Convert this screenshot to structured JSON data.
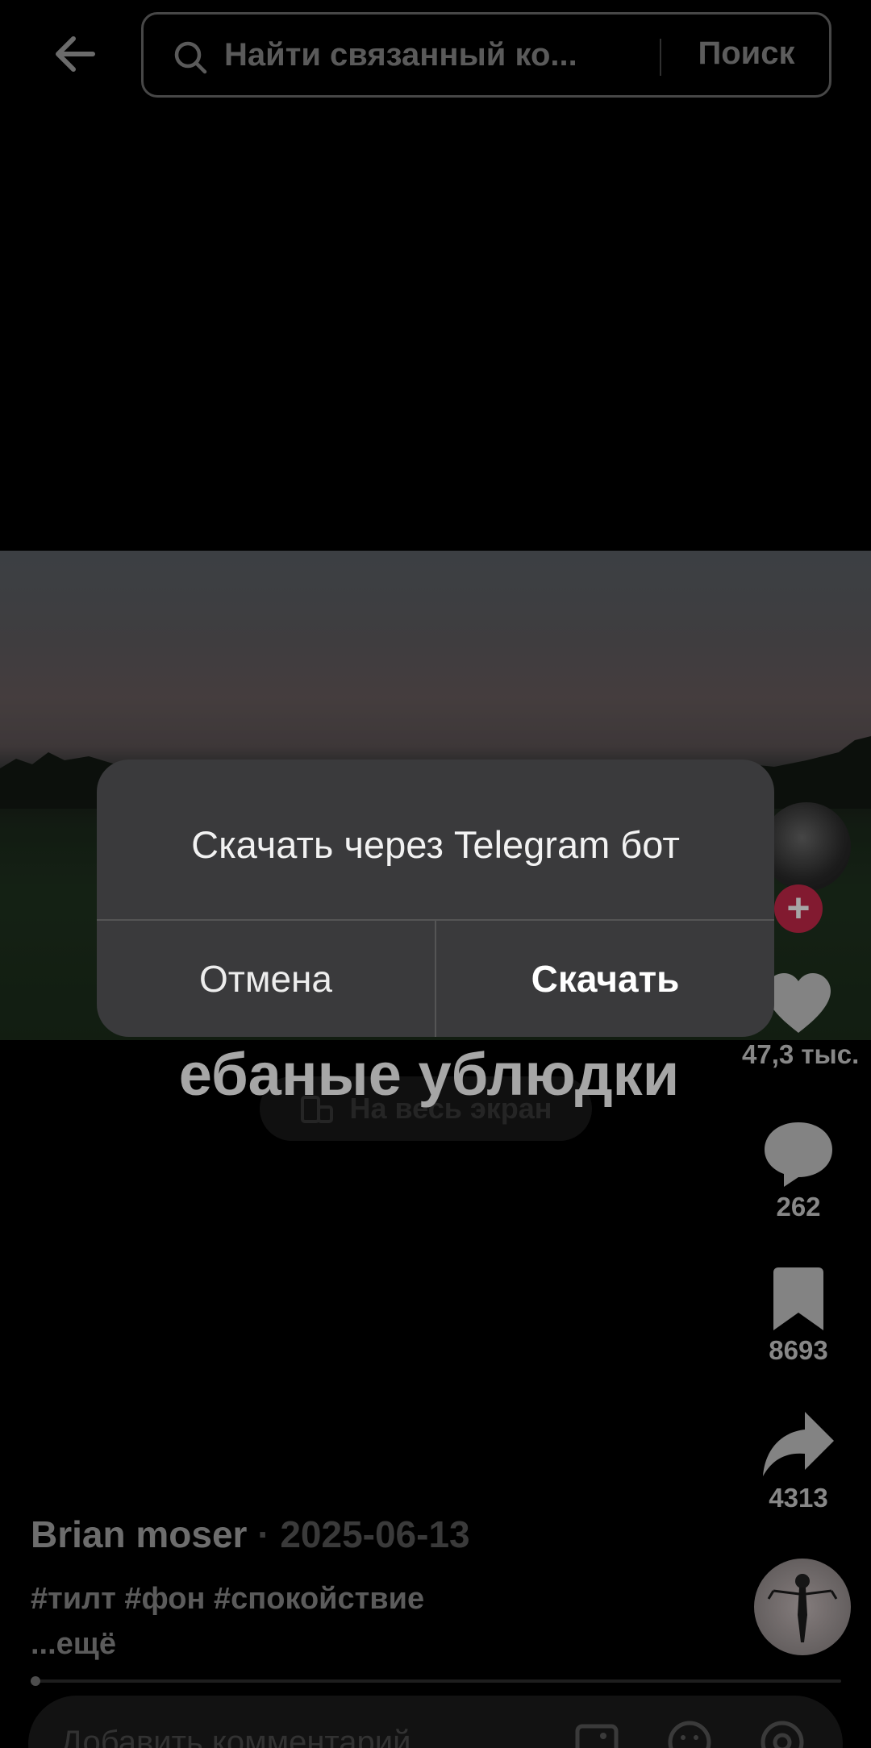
{
  "header": {
    "search_placeholder": "Найти связанный ко...",
    "search_button": "Поиск"
  },
  "video": {
    "caption": "ебаные ублюдки",
    "fullscreen_label": "На весь экран"
  },
  "dialog": {
    "title": "Скачать через Telegram бот",
    "cancel": "Отмена",
    "confirm": "Скачать"
  },
  "actions": {
    "likes": "47,3 тыс.",
    "comments": "262",
    "bookmarks": "8693",
    "shares": "4313"
  },
  "post": {
    "author": "Brian moser",
    "date": "· 2025-06-13",
    "hashtags": "#тилт #фон #спокойствие",
    "more": "...ещё",
    "progress": 0.01
  },
  "comment_bar": {
    "placeholder": "Добавить комментарий..."
  },
  "colors": {
    "follow_accent": "#c8294a",
    "dialog_bg": "#3a3a3c"
  }
}
